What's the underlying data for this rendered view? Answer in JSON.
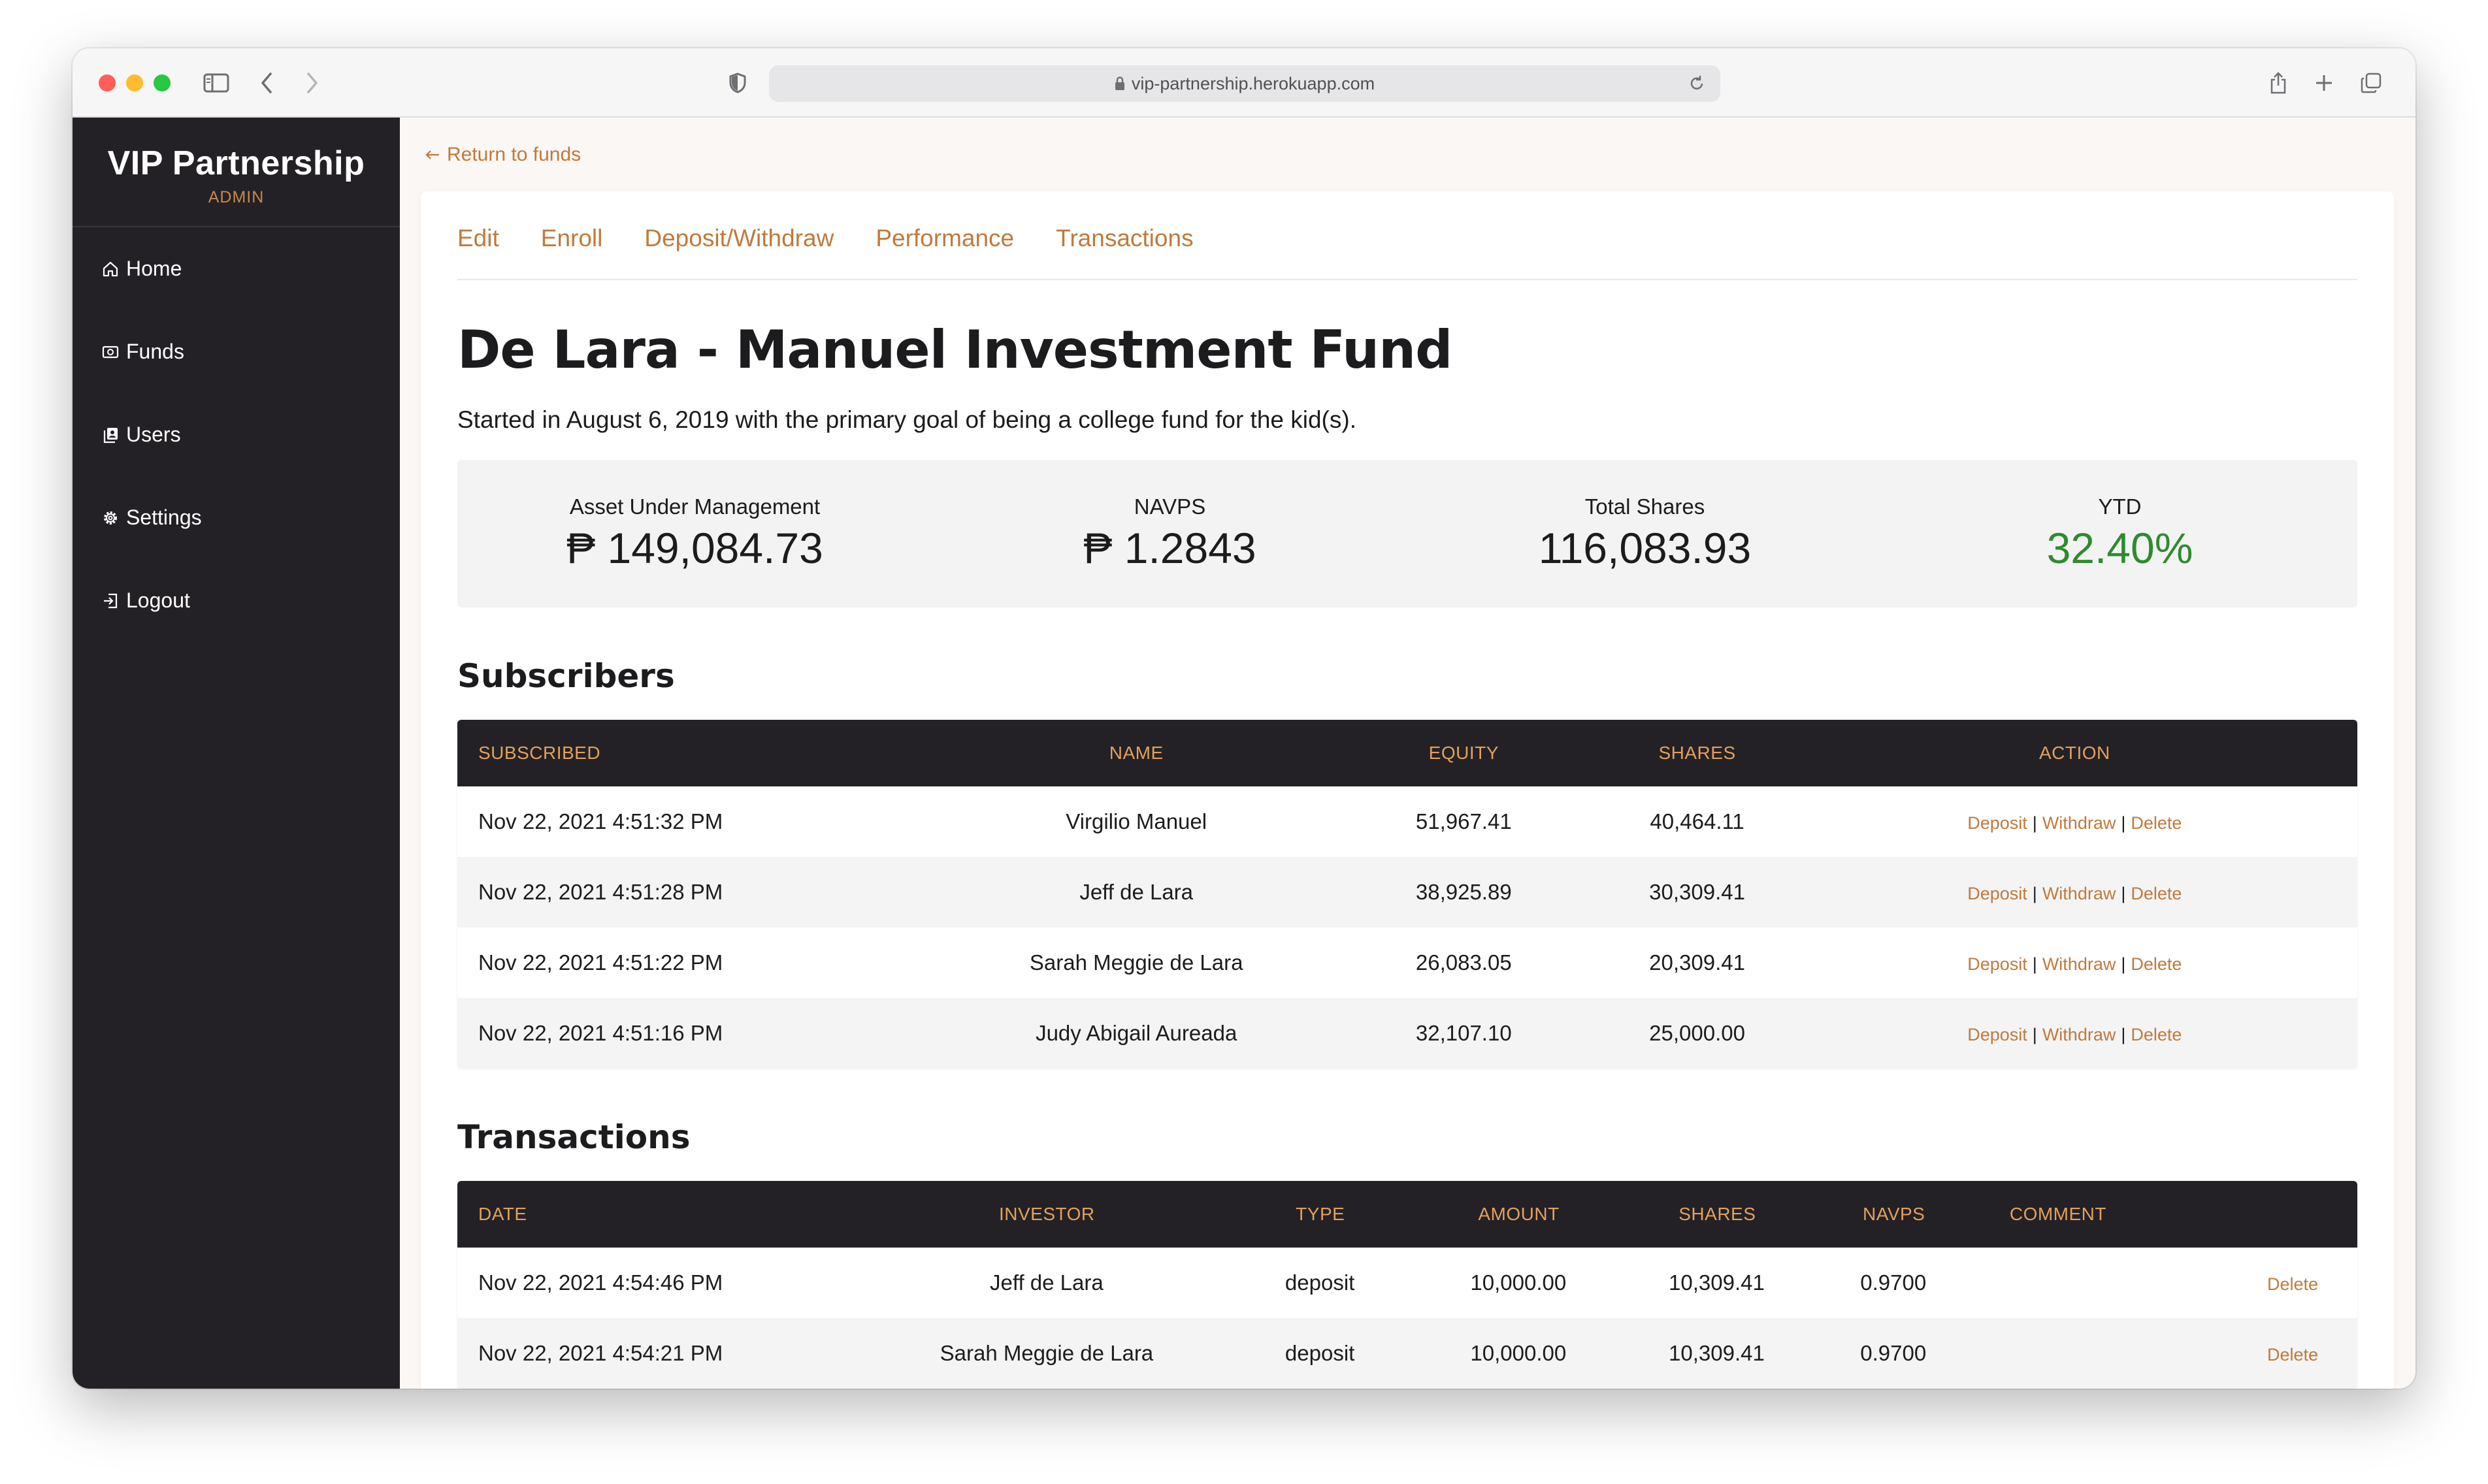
{
  "browser": {
    "url": "vip-partnership.herokuapp.com"
  },
  "sidebar": {
    "brand": "VIP Partnership",
    "role": "ADMIN",
    "items": [
      {
        "label": "Home",
        "icon": "home-icon"
      },
      {
        "label": "Funds",
        "icon": "funds-icon"
      },
      {
        "label": "Users",
        "icon": "users-icon"
      },
      {
        "label": "Settings",
        "icon": "gear-icon"
      },
      {
        "label": "Logout",
        "icon": "logout-icon"
      }
    ]
  },
  "main": {
    "return_label": "Return to funds",
    "tabs": [
      "Edit",
      "Enroll",
      "Deposit/Withdraw",
      "Performance",
      "Transactions"
    ],
    "title": "De Lara - Manuel Investment Fund",
    "description": "Started in August 6, 2019 with the primary goal of being a college fund for the kid(s).",
    "stats": [
      {
        "label": "Asset Under Management",
        "value": "₱ 149,084.73"
      },
      {
        "label": "NAVPS",
        "value": "₱ 1.2843"
      },
      {
        "label": "Total Shares",
        "value": "116,083.93"
      },
      {
        "label": "YTD",
        "value": "32.40%",
        "color": "#2e8b2e"
      }
    ]
  },
  "subscribers": {
    "title": "Subscribers",
    "headers": [
      "SUBSCRIBED",
      "NAME",
      "EQUITY",
      "SHARES",
      "ACTION"
    ],
    "actions": {
      "deposit": "Deposit",
      "withdraw": "Withdraw",
      "delete": "Delete",
      "sep": "|"
    },
    "rows": [
      {
        "subscribed": "Nov 22, 2021 4:51:32 PM",
        "name": "Virgilio Manuel",
        "equity": "51,967.41",
        "shares": "40,464.11"
      },
      {
        "subscribed": "Nov 22, 2021 4:51:28 PM",
        "name": "Jeff de Lara",
        "equity": "38,925.89",
        "shares": "30,309.41"
      },
      {
        "subscribed": "Nov 22, 2021 4:51:22 PM",
        "name": "Sarah Meggie de Lara",
        "equity": "26,083.05",
        "shares": "20,309.41"
      },
      {
        "subscribed": "Nov 22, 2021 4:51:16 PM",
        "name": "Judy Abigail Aureada",
        "equity": "32,107.10",
        "shares": "25,000.00"
      }
    ]
  },
  "transactions": {
    "title": "Transactions",
    "headers": [
      "DATE",
      "INVESTOR",
      "TYPE",
      "AMOUNT",
      "SHARES",
      "NAVPS",
      "COMMENT"
    ],
    "delete_label": "Delete",
    "rows": [
      {
        "date": "Nov 22, 2021 4:54:46 PM",
        "investor": "Jeff de Lara",
        "type": "deposit",
        "amount": "10,000.00",
        "shares": "10,309.41",
        "navps": "0.9700",
        "comment": ""
      },
      {
        "date": "Nov 22, 2021 4:54:21 PM",
        "investor": "Sarah Meggie de Lara",
        "type": "deposit",
        "amount": "10,000.00",
        "shares": "10,309.41",
        "navps": "0.9700",
        "comment": ""
      }
    ]
  },
  "colors": {
    "accent": "#c07a3b",
    "sidebar_bg": "#232125",
    "header_text": "#e4a05c",
    "positive": "#2e8b2e"
  }
}
